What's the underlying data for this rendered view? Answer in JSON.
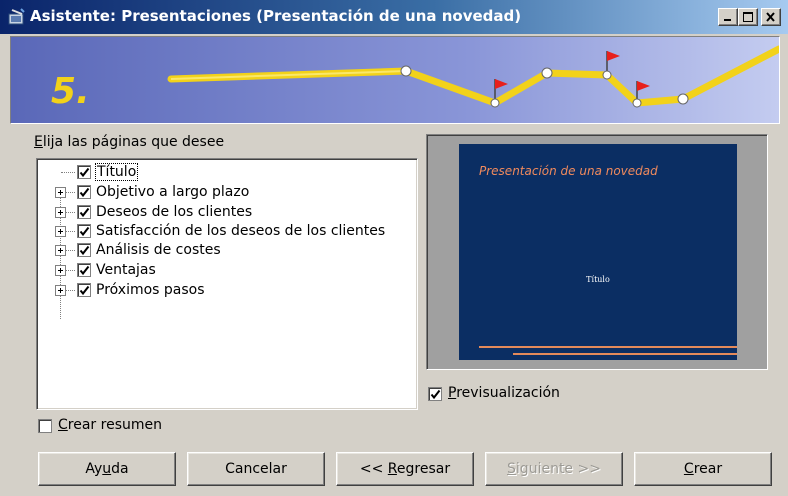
{
  "window": {
    "title": "Asistente: Presentaciones (Presentación de una novedad)",
    "controls": {
      "minimize": "minimize-icon",
      "maximize": "maximize-icon",
      "close": "close-icon"
    }
  },
  "banner": {
    "step": "5."
  },
  "pages": {
    "label_pre": "",
    "label_key": "E",
    "label_post": "lija las páginas que desee",
    "items": [
      {
        "label": "Título",
        "checked": true,
        "expandable": false
      },
      {
        "label": "Objetivo a largo plazo",
        "checked": true,
        "expandable": true
      },
      {
        "label": "Deseos de los clientes",
        "checked": true,
        "expandable": true
      },
      {
        "label": "Satisfacción de los deseos de los clientes",
        "checked": true,
        "expandable": true
      },
      {
        "label": "Análisis de costes",
        "checked": true,
        "expandable": true
      },
      {
        "label": "Ventajas",
        "checked": true,
        "expandable": true
      },
      {
        "label": "Próximos pasos",
        "checked": true,
        "expandable": true
      }
    ]
  },
  "preview": {
    "slide_title": "Presentación de una novedad",
    "slide_subtitle": "Título",
    "toggle": {
      "key": "P",
      "rest": "revisualización",
      "checked": true
    }
  },
  "summary": {
    "key": "C",
    "rest": "rear resumen",
    "checked": false
  },
  "buttons": {
    "help": {
      "pre": "Ay",
      "key": "u",
      "post": "da"
    },
    "cancel": "Cancelar",
    "back": {
      "pre": "<< ",
      "key": "R",
      "post": "egresar"
    },
    "next": {
      "pre": "",
      "key": "S",
      "post": "iguiente >>",
      "disabled": true
    },
    "create": {
      "pre": "",
      "key": "C",
      "post": "rear"
    }
  },
  "colors": {
    "titlebar": "#0a246a",
    "slide_bg": "#0b2e63",
    "slide_accent": "#f08a5d",
    "path": "#f2d21a",
    "flag": "#e8201c"
  }
}
